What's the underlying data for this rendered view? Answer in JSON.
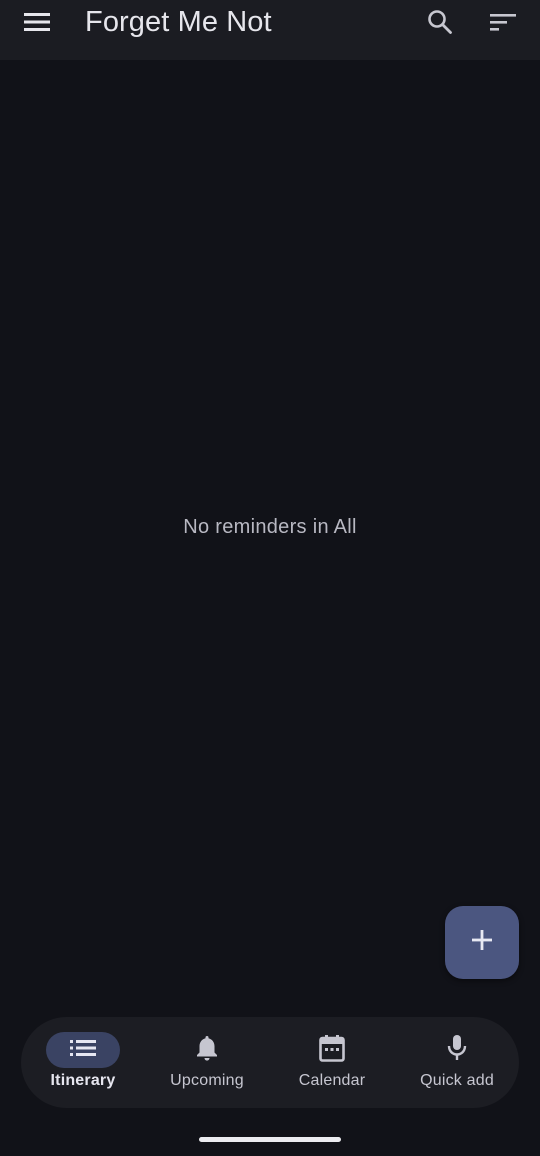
{
  "app_bar": {
    "title": "Forget Me Not",
    "menu_icon": "hamburger-menu-icon",
    "search_icon": "search-icon",
    "sort_icon": "sort-filter-icon"
  },
  "main": {
    "empty_message": "No reminders in All"
  },
  "fab": {
    "icon": "plus-icon"
  },
  "bottom_nav": {
    "items": [
      {
        "label": "Itinerary",
        "icon": "list-icon",
        "active": true
      },
      {
        "label": "Upcoming",
        "icon": "bell-icon",
        "active": false
      },
      {
        "label": "Calendar",
        "icon": "calendar-icon",
        "active": false
      },
      {
        "label": "Quick add",
        "icon": "microphone-icon",
        "active": false
      }
    ]
  },
  "colors": {
    "background": "#111218",
    "app_bar": "#1b1c22",
    "fab": "#4b5680",
    "nav_active_pill": "#3a4363"
  }
}
